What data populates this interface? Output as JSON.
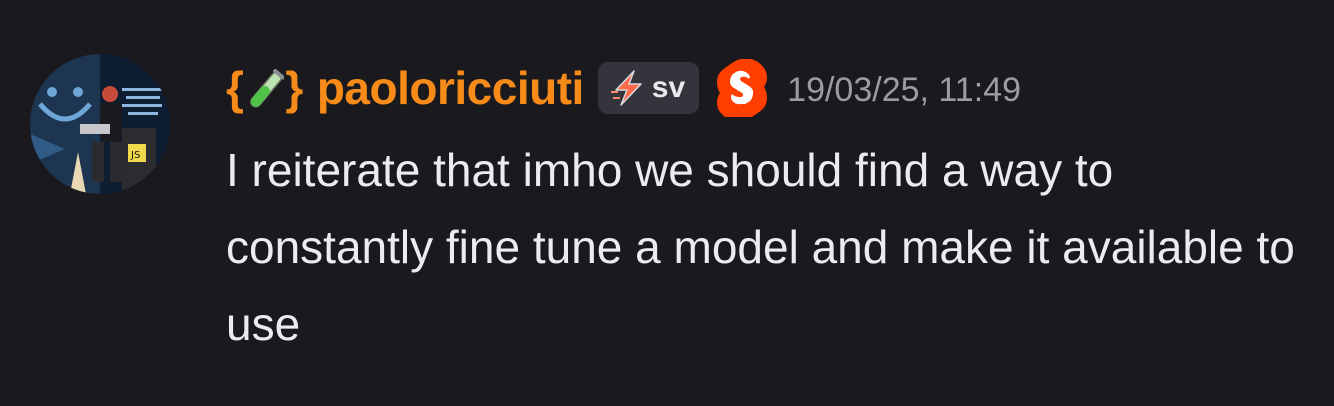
{
  "message": {
    "author": {
      "prefix": "{",
      "suffix": "}",
      "name": "paoloricciuti",
      "name_color": "#f78b1a",
      "decor_icon": "test-tube-icon"
    },
    "tag": {
      "icon": "lightning-bolt-icon",
      "text": "sv"
    },
    "role_icon": "svelte-logo-icon",
    "timestamp": "19/03/25, 11:49",
    "text": "I reiterate that imho we should find a way to constantly fine tune a model and make it available to use"
  },
  "colors": {
    "background": "#1a191e",
    "text": "#ececf0",
    "timestamp": "#9b9ba4",
    "badge_bg": "#34343c",
    "svelte": "#ff3e00"
  }
}
